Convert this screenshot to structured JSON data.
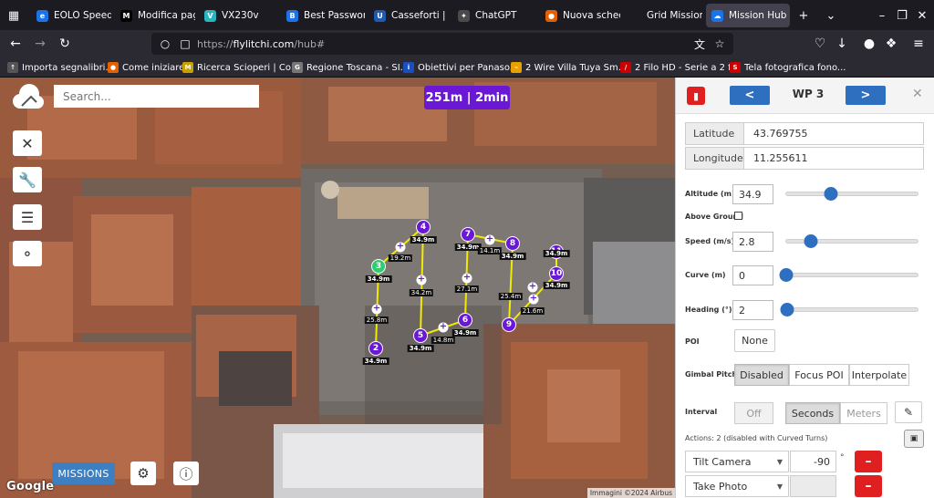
{
  "browser": {
    "tabs": [
      {
        "label": "EOLO Speed te",
        "fav_color": "#1a73e8",
        "fav_glyph": "e"
      },
      {
        "label": "Modifica pagin",
        "fav_color": "#000000",
        "fav_glyph": "M"
      },
      {
        "label": "VX230v",
        "fav_color": "#2bb3c0",
        "fav_glyph": "V"
      },
      {
        "label": "Best Password",
        "fav_color": "#1a73e8",
        "fav_glyph": "B"
      },
      {
        "label": "Casseforti | Co",
        "fav_color": "#1e5ab4",
        "fav_glyph": "U"
      },
      {
        "label": "ChatGPT",
        "fav_color": "#4a4a4a",
        "fav_glyph": "✦"
      },
      {
        "label": "Nuova scheda",
        "fav_color": "#e66000",
        "fav_glyph": "●"
      },
      {
        "label": "Grid Mission Desi",
        "fav_color": "#1c1b22",
        "fav_glyph": ""
      },
      {
        "label": "Mission Hub",
        "fav_color": "#1a73e8",
        "fav_glyph": "☁"
      }
    ],
    "new_tab_glyph": "+",
    "url_protocol": "https://",
    "url_host": "flylitchi.com",
    "url_path": "/hub#",
    "bookmarks": [
      {
        "label": "Importa segnalibri...",
        "fav_color": "#555555",
        "fav_glyph": "↑"
      },
      {
        "label": "Come iniziare",
        "fav_color": "#e66000",
        "fav_glyph": "●"
      },
      {
        "label": "Ricerca Scioperi | Co...",
        "fav_color": "#c8a000",
        "fav_glyph": "M"
      },
      {
        "label": "Regione Toscana - SI...",
        "fav_color": "#777777",
        "fav_glyph": "G"
      },
      {
        "label": "Obiettivi per Panaso...",
        "fav_color": "#1a4fbf",
        "fav_glyph": "i"
      },
      {
        "label": "2 Wire Villa Tuya Sm...",
        "fav_color": "#e8a000",
        "fav_glyph": "⌁"
      },
      {
        "label": "2 Filo HD - Serie a 2 f...",
        "fav_color": "#cc0000",
        "fav_glyph": "/"
      },
      {
        "label": "Tela fotografica fono...",
        "fav_color": "#cc0000",
        "fav_glyph": "S"
      }
    ]
  },
  "map": {
    "search_placeholder": "Search...",
    "stats": "251m | 2min",
    "missions_label": "MISSIONS",
    "google_label": "Google",
    "credit": "Immagini ©2024 Airbus",
    "waypoints": [
      {
        "num": "2",
        "alt": "34.9m"
      },
      {
        "num": "3",
        "alt": "34.9m"
      },
      {
        "num": "4",
        "alt": "34.9m"
      },
      {
        "num": "5",
        "alt": "34.9m"
      },
      {
        "num": "6",
        "alt": "34.9m"
      },
      {
        "num": "7",
        "alt": "34.9m"
      },
      {
        "num": "8",
        "alt": "34.9m"
      },
      {
        "num": "9",
        "alt": ""
      },
      {
        "num": "10",
        "alt": "34.9m"
      },
      {
        "num": "11",
        "alt": "34.9m"
      }
    ],
    "distances": [
      "25.8m",
      "19.2m",
      "34.2m",
      "14.8m",
      "27.1m",
      "14.1m",
      "25.4m",
      "21.6m"
    ]
  },
  "panel": {
    "title": "WP 3",
    "prev_label": "<",
    "next_label": ">",
    "close_glyph": "✕",
    "latitude_label": "Latitude",
    "latitude": "43.769755",
    "longitude_label": "Longitude",
    "longitude": "11.255611",
    "altitude_label": "Altitude (m)",
    "altitude": "34.9",
    "altitude_fraction": 0.34,
    "above_ground_label": "Above Ground",
    "speed_label": "Speed (m/s)",
    "speed": "2.8",
    "speed_fraction": 0.19,
    "curve_label": "Curve (m)",
    "curve": "0",
    "curve_fraction": 0,
    "heading_label": "Heading (°)",
    "heading": "2",
    "heading_fraction": 0.005,
    "poi_label": "POI",
    "poi_value": "None",
    "gimbal_label": "Gimbal Pitch",
    "gimbal_options": [
      "Disabled",
      "Focus POI",
      "Interpolate"
    ],
    "interval_label": "Interval",
    "interval_value": "Off",
    "interval_units": [
      "Seconds",
      "Meters"
    ],
    "actions_label": "Actions: 2 (disabled with Curved Turns)",
    "actions": [
      {
        "type": "Tilt Camera",
        "value": "-90",
        "unit": "°"
      },
      {
        "type": "Take Photo",
        "value": "",
        "unit": ""
      }
    ]
  }
}
